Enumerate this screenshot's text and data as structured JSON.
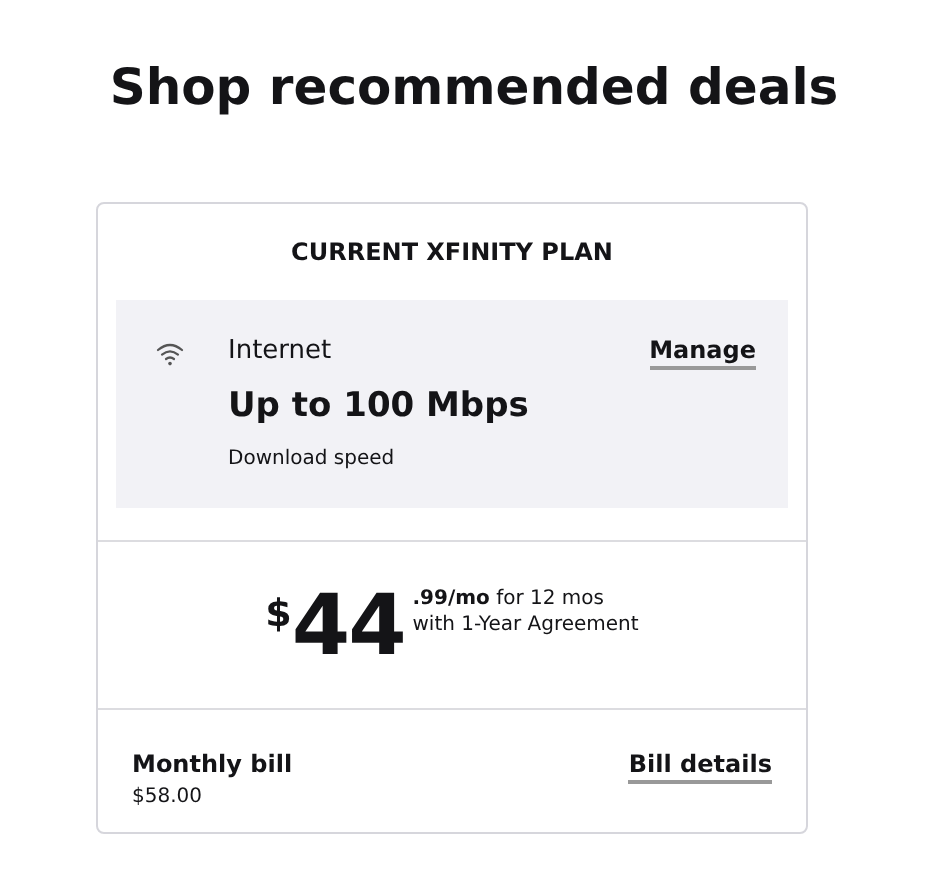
{
  "heading": "Shop recommended deals",
  "plan": {
    "title": "CURRENT XFINITY PLAN",
    "service": "Internet",
    "speed": "Up to 100 Mbps",
    "speed_label": "Download speed",
    "manage_link": "Manage"
  },
  "price": {
    "currency": "$",
    "dollars": "44",
    "terms": "**.99/mo** for 12 mos",
    "agreement": "with 1-Year Agreement"
  },
  "bill": {
    "label": "Monthly bill",
    "amount": "$58.00",
    "details_link": "Bill details"
  }
}
